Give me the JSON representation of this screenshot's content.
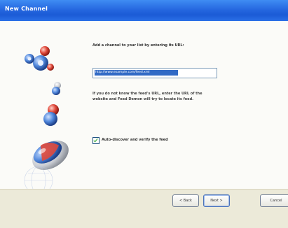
{
  "window": {
    "title": "New Channel"
  },
  "wizard": {
    "instruction": "Add a channel to your list by entering its URL:",
    "url_value": "http://www.example.com/feed.xml",
    "help_text": "If you do not know the feed's URL, enter the URL of the website and Feed Demon will try to locate its feed.",
    "autodiscover": {
      "label": "Auto-discover and verify the feed",
      "checked": true
    }
  },
  "buttons": {
    "back": "< Back",
    "next": "Next >",
    "cancel": "Cancel"
  },
  "colors": {
    "title_bar": "#2668e0",
    "selection": "#316ac5",
    "footer": "#ecead9"
  },
  "icons": [
    "gears-icon",
    "ball-icon",
    "dish-icon"
  ]
}
